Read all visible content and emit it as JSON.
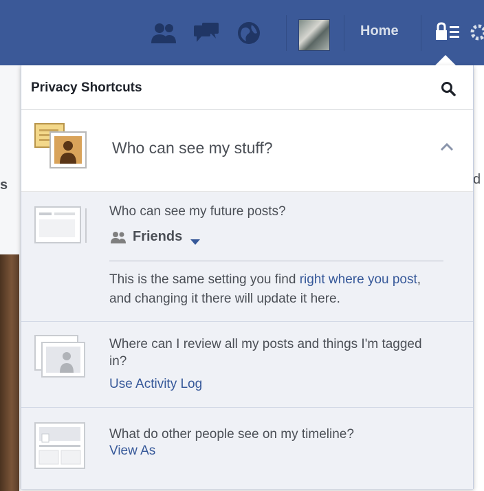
{
  "topbar": {
    "home_label": "Home",
    "icons": [
      "friend-requests-icon",
      "messages-icon",
      "notifications-globe-icon"
    ],
    "colors": {
      "bar": "#3b5998",
      "text": "#d8dfea"
    }
  },
  "panel": {
    "title": "Privacy Shortcuts",
    "search_icon": "search-icon"
  },
  "section": {
    "title": "Who can see my stuff?",
    "expanded": true
  },
  "items": [
    {
      "question": "Who can see my future posts?",
      "audience": "Friends",
      "note_prefix": "This is the same setting you find ",
      "note_link": "right where you post",
      "note_suffix": ", and changing it there will update it here."
    },
    {
      "question": "Where can I review all my posts and things I'm tagged in?",
      "link": "Use Activity Log"
    },
    {
      "question": "What do other people see on my timeline?",
      "link": "View As"
    }
  ],
  "colors": {
    "link": "#365899",
    "text": "#4b4f56",
    "sub_bg": "#eff1f6"
  }
}
